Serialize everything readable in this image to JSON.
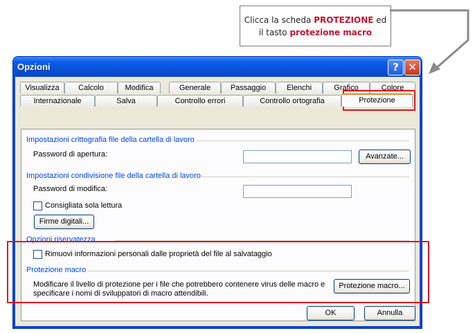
{
  "callout": {
    "line1_prefix": "Clicca la scheda ",
    "line1_bold": "PROTEZIONE",
    "line1_suffix": " ed",
    "line2_prefix": "il tasto ",
    "line2_bold": "protezione macro"
  },
  "window": {
    "title": "Opzioni",
    "help_glyph": "?",
    "close_glyph": "✕"
  },
  "tabs_row1": [
    "Visualizza",
    "Calcolo",
    "Modifica",
    "Generale",
    "Passaggio",
    "Elenchi",
    "Grafico",
    "Colore"
  ],
  "tabs_row2": [
    "Internazionale",
    "Salva",
    "Controllo errori",
    "Controllo ortografia",
    "Protezione"
  ],
  "selected_tab": "Protezione",
  "encryption": {
    "title": "Impostazioni crittografia file della cartella di lavoro",
    "password_label": "Password di apertura:",
    "password_value": "",
    "advanced_button": "Avanzate..."
  },
  "sharing": {
    "title": "Impostazioni condivisione file della cartella di lavoro",
    "password_label": "Password di modifica:",
    "password_value": "",
    "readonly_label": "Consigliata sola lettura",
    "readonly_checked": false,
    "signatures_button": "Firme digitali..."
  },
  "privacy": {
    "title": "Opzioni riservatezza",
    "remove_info_label": "Rimuovi informazioni personali dalle proprietà del file al salvataggio",
    "remove_info_checked": false
  },
  "macro": {
    "title": "Protezione macro",
    "desc_line1": "Modificare il livello di protezione per i file che potrebbero contenere virus delle macro e",
    "desc_line2": "specificare i nomi di sviluppatori di macro attendibili.",
    "button": "Protezione macro..."
  },
  "footer": {
    "ok": "OK",
    "cancel": "Annulla"
  },
  "colors": {
    "highlight": "#e0141e",
    "callout_accent": "#c8102e",
    "section_title": "#0046d5"
  }
}
